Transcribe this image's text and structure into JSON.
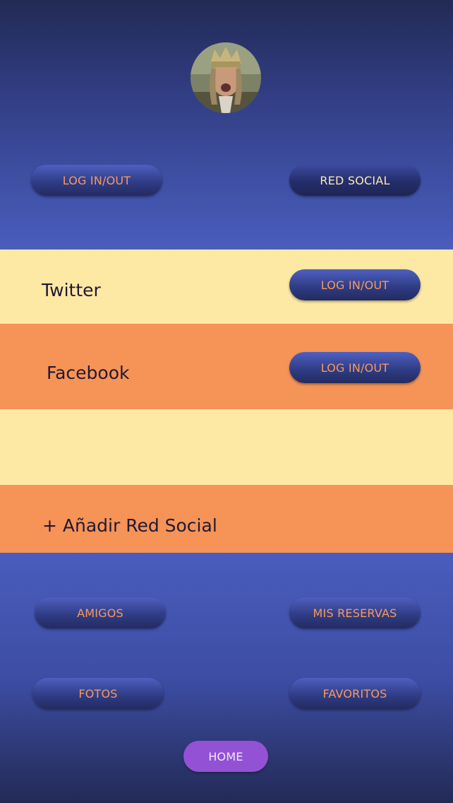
{
  "header": {
    "avatar_alt": "profile-photo",
    "login_label": "LOG IN/OUT",
    "social_label": "RED SOCIAL"
  },
  "networks": [
    {
      "name": "Twitter",
      "action_label": "LOG IN/OUT"
    },
    {
      "name": "Facebook",
      "action_label": "LOG IN/OUT"
    }
  ],
  "add_network_label": "+ Añadir Red Social",
  "menu": {
    "friends_label": "AMIGOS",
    "reservations_label": "MIS RESERVAS",
    "photos_label": "FOTOS",
    "favorites_label": "FAVORITOS",
    "home_label": "HOME"
  },
  "colors": {
    "cream": "#fde9a4",
    "orange": "#f69356",
    "accent_text": "#f79a5c",
    "home": "#9352d6"
  }
}
